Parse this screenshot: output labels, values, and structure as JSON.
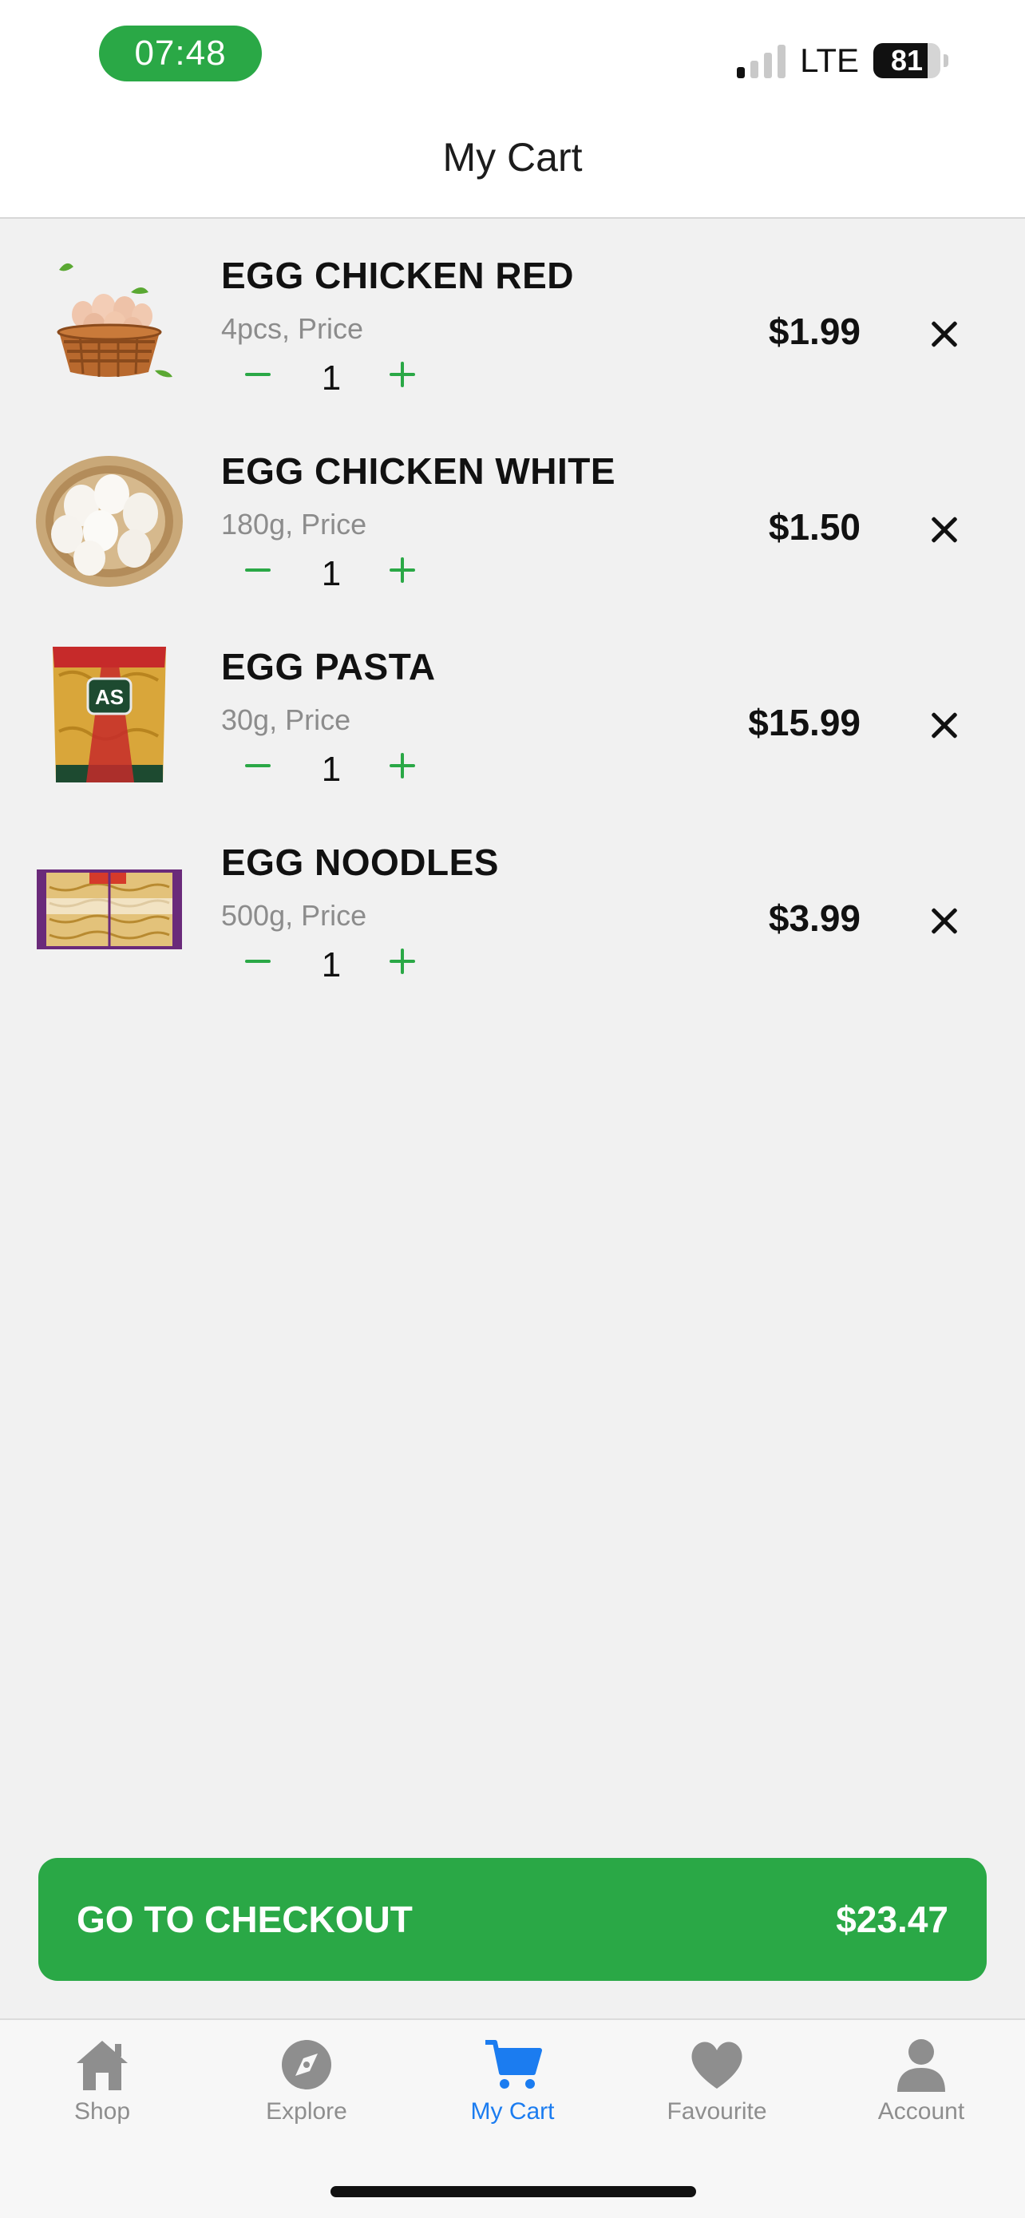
{
  "status_bar": {
    "time": "07:48",
    "network": "LTE",
    "battery": "81",
    "battery_level": 0.81,
    "signal_bars_on": 1,
    "signal_bars_total": 4
  },
  "header": {
    "title": "My Cart"
  },
  "cart": {
    "items": [
      {
        "name": "EGG CHICKEN RED",
        "subtitle": "4pcs, Price",
        "quantity": "1",
        "price": "$1.99",
        "image": "egg-basket-red-image"
      },
      {
        "name": "EGG CHICKEN WHITE",
        "subtitle": "180g, Price",
        "quantity": "1",
        "price": "$1.50",
        "image": "egg-basket-white-image"
      },
      {
        "name": "EGG PASTA",
        "subtitle": "30g, Price",
        "quantity": "1",
        "price": "$15.99",
        "image": "egg-pasta-bag-image"
      },
      {
        "name": "EGG NOODLES",
        "subtitle": "500g, Price",
        "quantity": "1",
        "price": "$3.99",
        "image": "egg-noodles-pack-image"
      }
    ]
  },
  "checkout": {
    "label": "GO TO CHECKOUT",
    "total": "$23.47"
  },
  "tabbar": {
    "tabs": [
      {
        "label": "Shop",
        "icon": "home-icon"
      },
      {
        "label": "Explore",
        "icon": "compass-icon"
      },
      {
        "label": "My Cart",
        "icon": "cart-icon",
        "active": true
      },
      {
        "label": "Favourite",
        "icon": "heart-icon"
      },
      {
        "label": "Account",
        "icon": "person-icon"
      }
    ]
  },
  "colors": {
    "accent": "#2aa846",
    "active_tab": "#1b7cf0",
    "inactive_tab": "#8e8e8e",
    "background": "#f1f1f1"
  }
}
